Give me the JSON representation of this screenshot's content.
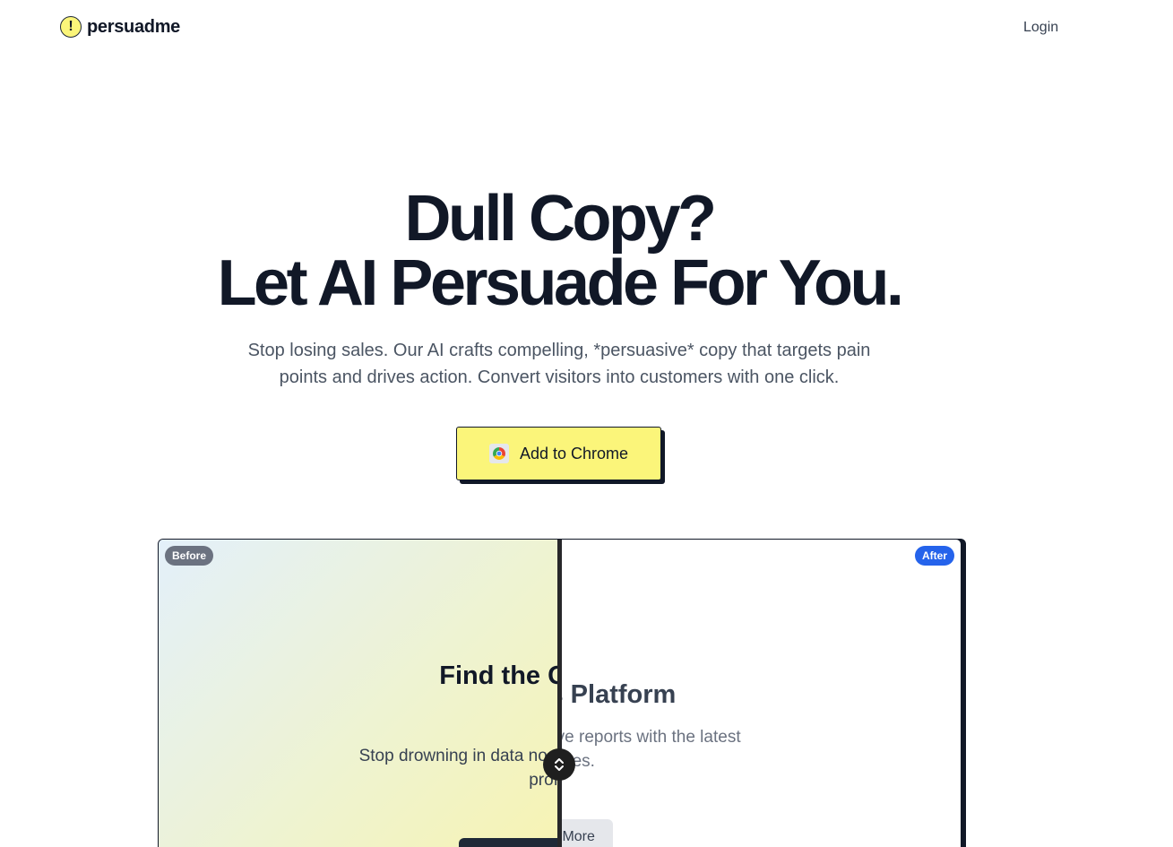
{
  "nav": {
    "logo_mark": "!",
    "brand": "persuadme",
    "login": "Login"
  },
  "hero": {
    "title_line1": "Dull Copy?",
    "title_line2": "Let AI Persuade For You.",
    "subtitle": "Stop losing sales. Our AI crafts compelling, *persuasive* copy that targets pain points and drives action. Convert visitors into customers with one click.",
    "cta_label": "Add to Chrome",
    "cta_icon": "chrome-icon"
  },
  "comparison": {
    "before_badge": "Before",
    "after_badge": "After",
    "before": {
      "heading": "Find the Growth Da",
      "text": "Stop drowning in data no drives revenue & slash was profitabl"
    },
    "after": {
      "heading": "Analytics Platform",
      "text": "Generate comprehensive reports with the latest features.",
      "button": "Learn More"
    }
  },
  "colors": {
    "accent_yellow": "#fbf57a",
    "ink": "#111827",
    "after_badge_blue": "#2563eb",
    "before_badge_gray": "#6b7280"
  }
}
